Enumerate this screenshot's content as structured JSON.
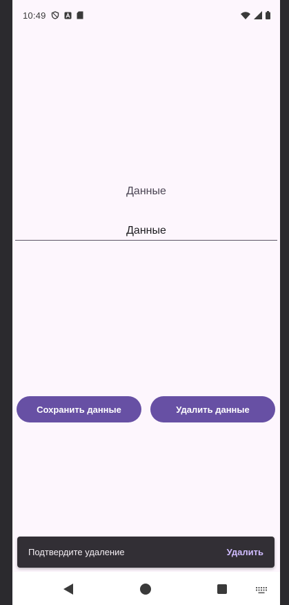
{
  "status_bar": {
    "time": "10:49",
    "icons_left": [
      "shield-icon",
      "font-a-icon",
      "sd-card-icon"
    ],
    "icons_right": [
      "wifi-icon",
      "signal-icon",
      "battery-icon"
    ]
  },
  "main": {
    "label": "Данные",
    "input_value": "Данные"
  },
  "buttons": {
    "save_label": "Сохранить данные",
    "delete_label": "Удалить данные"
  },
  "snackbar": {
    "message": "Подтвердите удаление",
    "action_label": "Удалить"
  },
  "nav_bar": {
    "icons": [
      "back-icon",
      "home-icon",
      "recents-icon",
      "keyboard-icon"
    ]
  },
  "colors": {
    "background": "#fdf6fd",
    "primary": "#6750a4",
    "snackbar_bg": "#322f35",
    "snackbar_action": "#d0bcff"
  }
}
